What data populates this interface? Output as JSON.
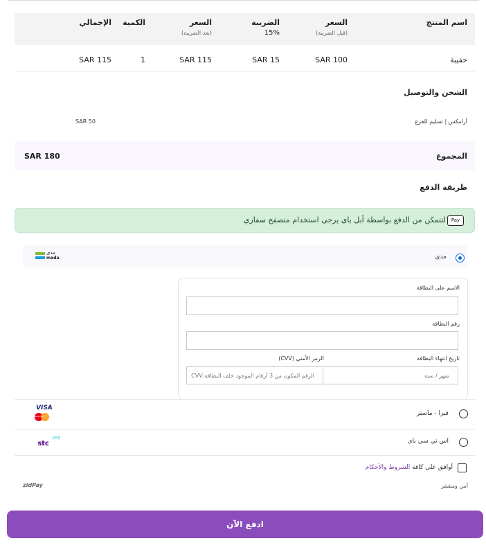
{
  "table": {
    "headers": {
      "product": "اسم المنتج",
      "price_before": "السعر",
      "price_before_sub": "(قبل الضريبة)",
      "tax": "الضريبة",
      "tax_rate": "15%",
      "price_after": "السعر",
      "price_after_sub": "(بعد الضريبة)",
      "quantity": "الكمية",
      "total": "الإجمالي"
    },
    "rows": [
      {
        "product": "حقيبة",
        "price_before": "SAR 100",
        "tax": "SAR 15",
        "price_after": "SAR 115",
        "quantity": "1",
        "total": "SAR 115"
      }
    ]
  },
  "shipping": {
    "title": "الشحن والتوصيل",
    "method": "أرامكس | تسليم للفرع",
    "price": "SAR 50"
  },
  "summary": {
    "label": "المجموع",
    "value": "SAR 180"
  },
  "payment": {
    "title": "طريقة الدفع",
    "apple_pay_notice": "لتتمكن من الدفع بواسطة أبل باي يرجى استخدام متصفح سفاري",
    "apple_pay_badge": "Pay",
    "mada": {
      "label": "مدى",
      "logo_ar": "مدى",
      "logo_en": "mada",
      "selected": true
    },
    "card_form": {
      "name_label": "الاسم على البطاقة",
      "number_label": "رقم البطاقة",
      "expiry_label": "تاريخ انتهاء البطاقة",
      "cvv_label": "الرمز الأمني (CVV)",
      "expiry_placeholder": "شهر / سنة",
      "cvv_placeholder": "الرقم المكون من 3 أرقام الموجود خلف البطاقة:CVV"
    },
    "visa_master": {
      "label": "فيزا - ماستر",
      "logo_text": "VISA",
      "mc_text": "MasterCard"
    },
    "stc_pay": {
      "label": "اس تي سي باي",
      "logo_main": "stc",
      "logo_sub": "pay"
    },
    "terms_prefix": "أوافق على كافة ",
    "terms_link": "الشروط والأحكام",
    "secure_text": "آمن ومشفر",
    "zidpay_logo": "zidPay",
    "pay_button": "ادفع الآن"
  },
  "colors": {
    "accent": "#8a4dbb",
    "alert_bg": "#d6efdc",
    "radio_selected": "#0a66d8",
    "mada_green": "#84b740",
    "mada_blue": "#259bd6",
    "stc_purple": "#4f008c",
    "stc_teal": "#1cbec3"
  },
  "icons": [
    "apple-pay-icon",
    "mada-logo",
    "visa-mastercard-logo",
    "stc-pay-logo",
    "zidpay-logo"
  ]
}
